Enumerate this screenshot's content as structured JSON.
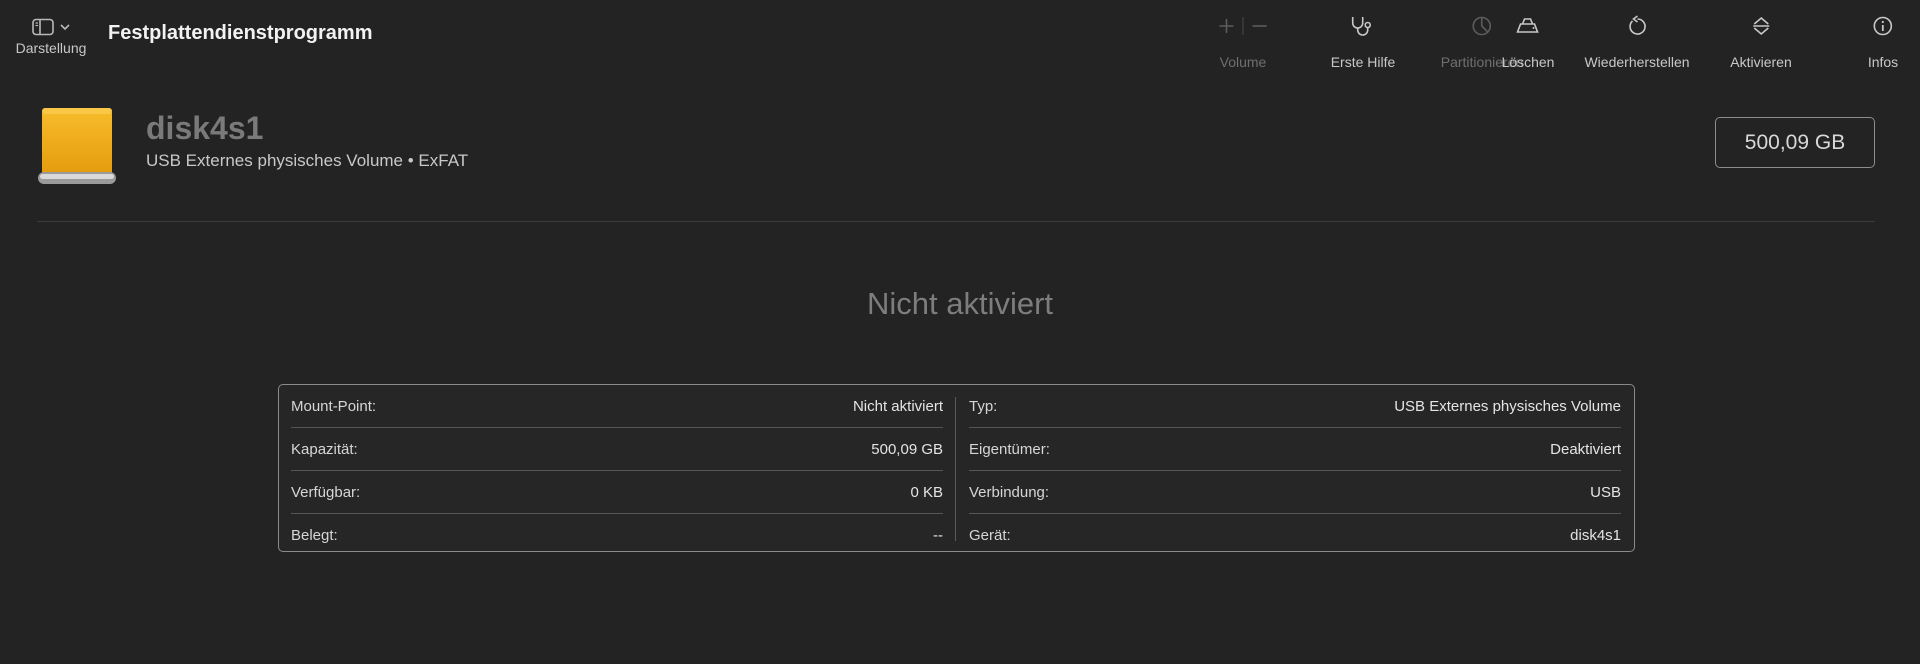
{
  "toolbar": {
    "view_label": "Darstellung",
    "app_title": "Festplattendienstprogramm",
    "volume_label": "Volume",
    "first_aid_label": "Erste Hilfe",
    "partition_label": "Partitionieren",
    "erase_label": "Löschen",
    "restore_label": "Wiederherstellen",
    "mount_label": "Aktivieren",
    "info_label": "Infos"
  },
  "disk": {
    "name": "disk4s1",
    "subtitle": "USB Externes physisches Volume • ExFAT",
    "size": "500,09 GB",
    "status": "Nicht aktiviert",
    "icon_color": "#f0a818"
  },
  "info": {
    "left": [
      {
        "key": "Mount-Point:",
        "value": "Nicht aktiviert"
      },
      {
        "key": "Kapazität:",
        "value": "500,09 GB"
      },
      {
        "key": "Verfügbar:",
        "value": "0 KB"
      },
      {
        "key": "Belegt:",
        "value": "--"
      }
    ],
    "right": [
      {
        "key": "Typ:",
        "value": "USB Externes physisches Volume"
      },
      {
        "key": "Eigentümer:",
        "value": "Deaktiviert"
      },
      {
        "key": "Verbindung:",
        "value": "USB"
      },
      {
        "key": "Gerät:",
        "value": "disk4s1"
      }
    ]
  }
}
